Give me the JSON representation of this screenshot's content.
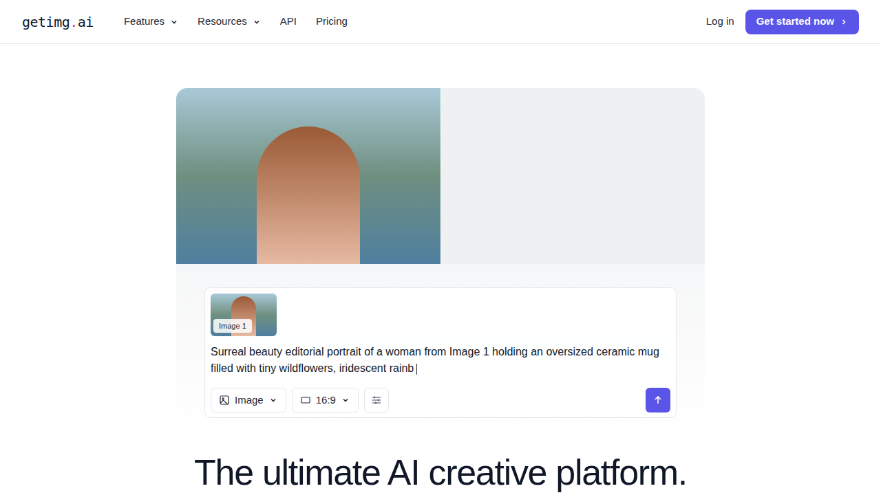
{
  "logo": {
    "name": "getimg",
    "dot": ".",
    "tld": "ai"
  },
  "nav": [
    {
      "label": "Features",
      "kind": "menu"
    },
    {
      "label": "Resources",
      "kind": "menu"
    },
    {
      "label": "API",
      "kind": "link"
    },
    {
      "label": "Pricing",
      "kind": "link"
    }
  ],
  "auth": {
    "login": "Log in",
    "cta": "Get started now"
  },
  "prompt": {
    "attachment_label": "Image 1",
    "text": "Surreal beauty editorial portrait of a woman from Image 1 holding an oversized ceramic mug filled with tiny wildflowers, iridescent rainb",
    "mode": "Image",
    "aspect": "16:9"
  },
  "headline": "The ultimate AI creative platform."
}
